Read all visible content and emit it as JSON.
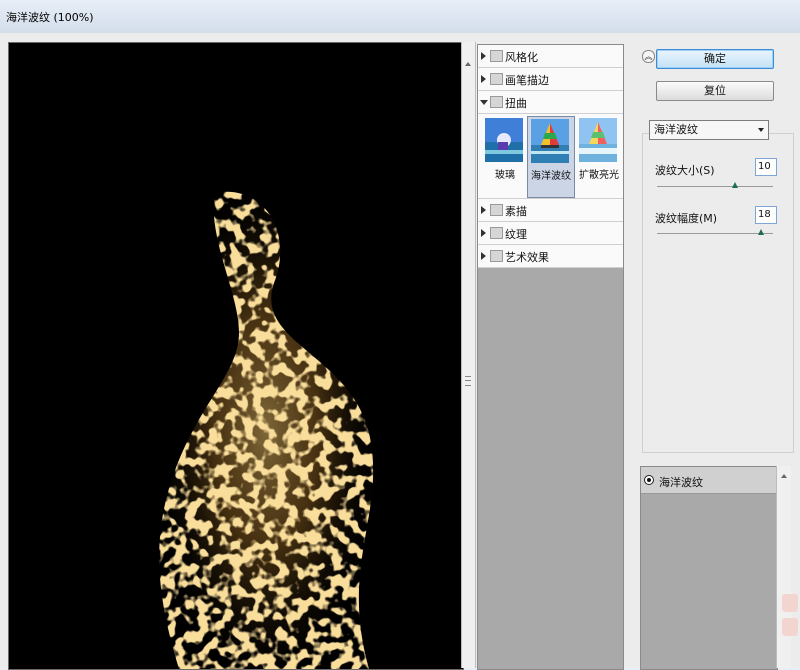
{
  "window": {
    "title": "海洋波纹 (100%)"
  },
  "categories": [
    {
      "label": "风格化",
      "expanded": false
    },
    {
      "label": "画笔描边",
      "expanded": false
    },
    {
      "label": "扭曲",
      "expanded": true
    },
    {
      "label": "素描",
      "expanded": false
    },
    {
      "label": "纹理",
      "expanded": false
    },
    {
      "label": "艺术效果",
      "expanded": false
    }
  ],
  "thumbnails": [
    {
      "label": "玻璃",
      "selected": false
    },
    {
      "label": "海洋波纹",
      "selected": true
    },
    {
      "label": "扩散亮光",
      "selected": false
    }
  ],
  "buttons": {
    "ok": "确定",
    "reset": "复位"
  },
  "filter": {
    "selected": "海洋波纹",
    "params": [
      {
        "label": "波纹大小(S)",
        "value": "10",
        "fraction": 0.67
      },
      {
        "label": "波纹幅度(M)",
        "value": "18",
        "fraction": 0.9
      }
    ]
  },
  "layers": [
    {
      "label": "海洋波纹",
      "visible": true
    }
  ],
  "colors": {
    "preview_bg": "#000000",
    "glow": "#d9a84a",
    "selection": "#cbd5e6"
  },
  "icons": [
    "collapse-icon",
    "eye-icon",
    "folder-icon",
    "expand-arrow-icon"
  ]
}
